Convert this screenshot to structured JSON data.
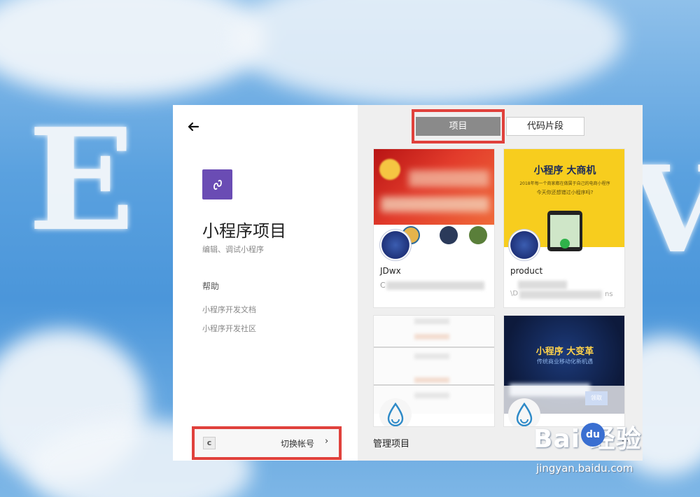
{
  "nav": {
    "back_icon": "arrow-left-icon"
  },
  "app": {
    "logo_icon": "mini-program-logo-icon",
    "title": "小程序项目",
    "subtitle": "编辑、调试小程序"
  },
  "help": {
    "heading": "帮助",
    "links": [
      "小程序开发文档",
      "小程序开发社区"
    ]
  },
  "account": {
    "avatar_letter": "c",
    "switch_label": "切换帐号",
    "chevron": "›"
  },
  "tabs": {
    "active": "项目",
    "inactive": "代码片段"
  },
  "projects": [
    {
      "name": "JDwx",
      "desc": "C",
      "banner": "red-flag-banner"
    },
    {
      "name": "product",
      "desc": "\\D",
      "desc_tail": "ns",
      "banner_title": "小程序 大商机",
      "banner_line1": "2018年每一个商家都在做属于自己的电商小程序",
      "banner_line2": "今天你还想错过小程序吗?"
    },
    {
      "name": "",
      "desc": "",
      "banner": "blank-banner"
    },
    {
      "name": "",
      "desc": "",
      "banner_title": "小程序 大变革",
      "banner_line1": "传统商业移动化新机遇",
      "button_label": "领取"
    }
  ],
  "footer": {
    "manage_label": "管理项目",
    "add_label": "+"
  },
  "watermark": {
    "brand": "Bai  经验",
    "paw": "du",
    "site": "jingyan.baidu.com"
  },
  "colors": {
    "highlight": "#e0413c",
    "logo_bg": "#6a4cb4",
    "tab_active_bg": "#8a8a8a"
  }
}
